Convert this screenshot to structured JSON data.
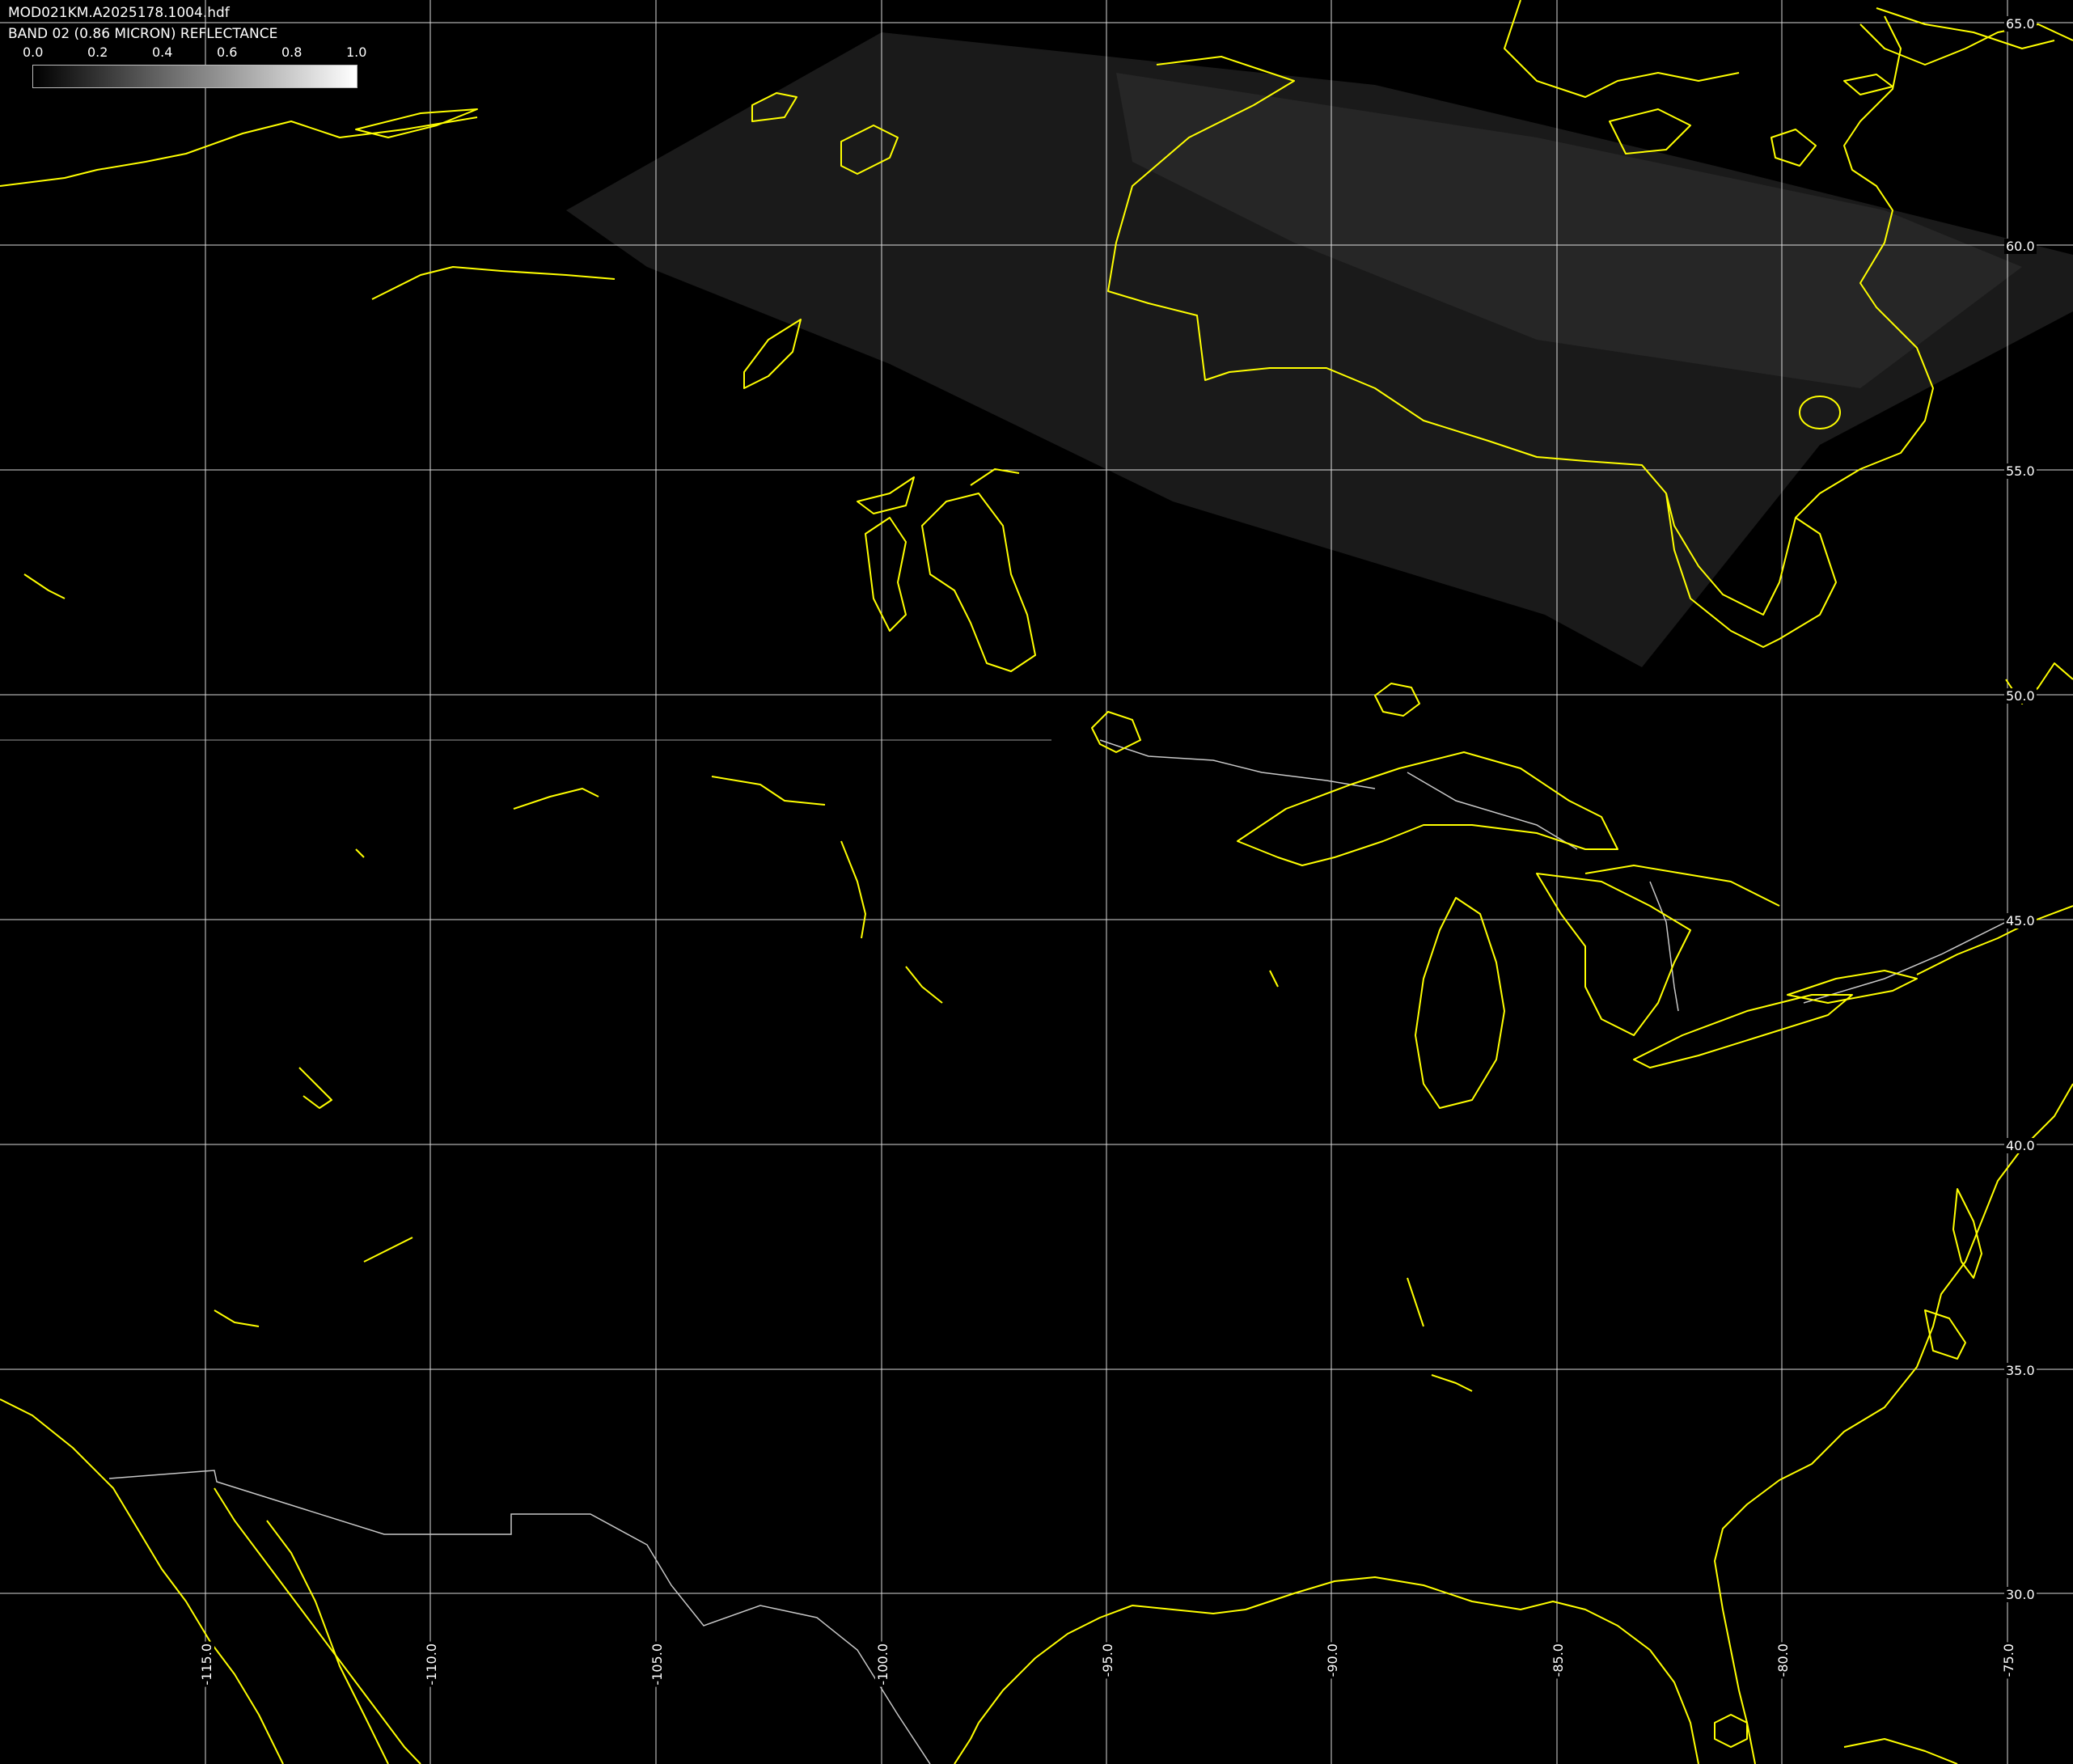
{
  "header": {
    "file_name": "MOD021KM.A2025178.1004.hdf",
    "band_label": "BAND 02 (0.86 MICRON) REFLECTANCE"
  },
  "colorbar": {
    "ticks": [
      "0.0",
      "0.2",
      "0.4",
      "0.6",
      "0.8",
      "1.0"
    ],
    "colors": {
      "low": "#000000",
      "high": "#ffffff"
    }
  },
  "grid": {
    "latitudes": [
      "65.0",
      "60.0",
      "55.0",
      "50.0",
      "45.0",
      "40.0",
      "35.0",
      "30.0"
    ],
    "longitudes": [
      "-115.0",
      "-110.0",
      "-105.0",
      "-100.0",
      "-95.0",
      "-90.0",
      "-85.0",
      "-80.0",
      "-75.0"
    ],
    "line_color": "#ffffff"
  },
  "style": {
    "coastline_color": "#ffff00",
    "border_color": "#c8c8c8",
    "background": "#000000"
  }
}
